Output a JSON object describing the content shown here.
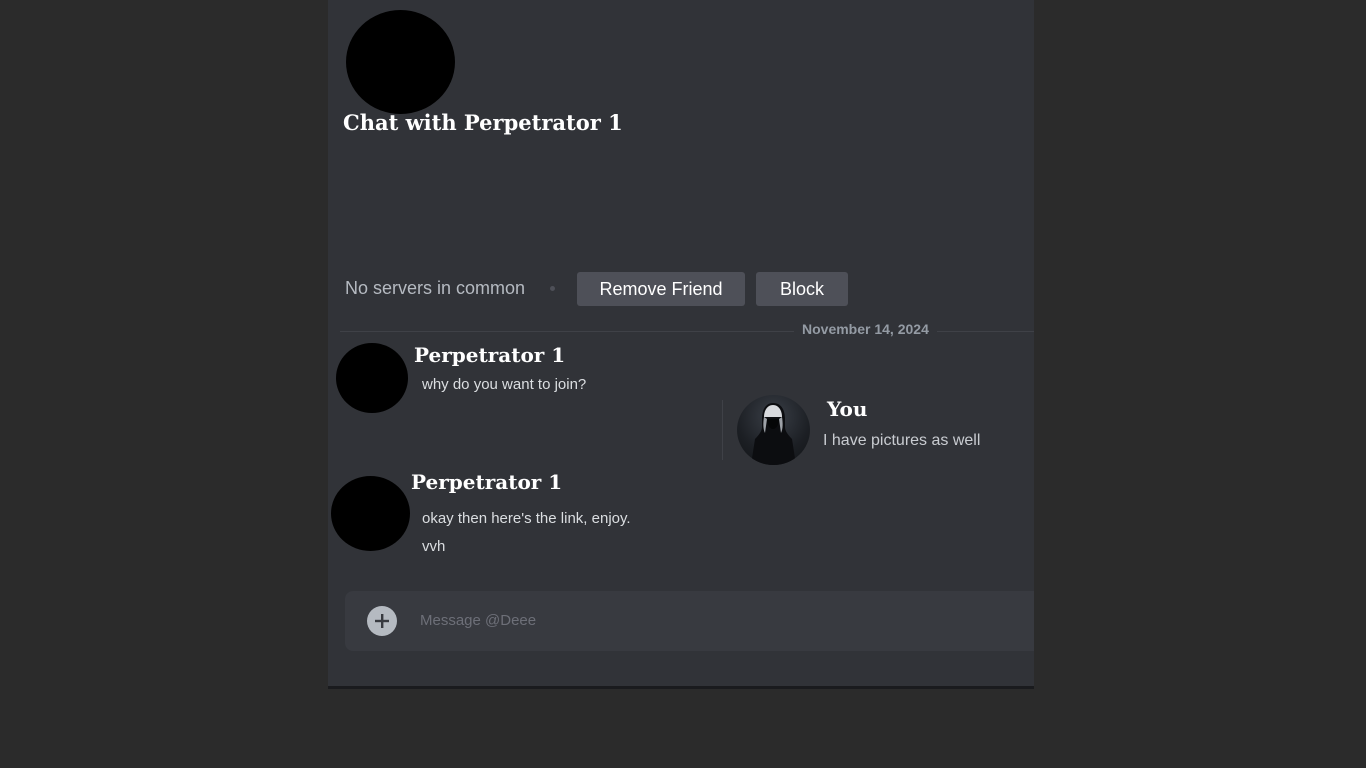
{
  "profile": {
    "chat_title": "Chat with Perpetrator 1",
    "servers_status": "No servers in common",
    "remove_friend_label": "Remove Friend",
    "block_label": "Block"
  },
  "chat": {
    "date_divider": "November 14, 2024",
    "messages": [
      {
        "author": "Perpetrator 1",
        "lines": [
          "why do you want to join?"
        ]
      },
      {
        "author": "You",
        "lines": [
          "I have pictures as well"
        ]
      },
      {
        "author": "Perpetrator 1",
        "lines": [
          "okay then here's the link, enjoy.",
          "vvh"
        ]
      }
    ]
  },
  "composer": {
    "placeholder": "Message @Deee",
    "attach_icon": "plus-circle-icon"
  },
  "colors": {
    "background": "#2b2b2b",
    "panel": "#313338",
    "button": "#4e5058",
    "composer": "#383a40"
  }
}
